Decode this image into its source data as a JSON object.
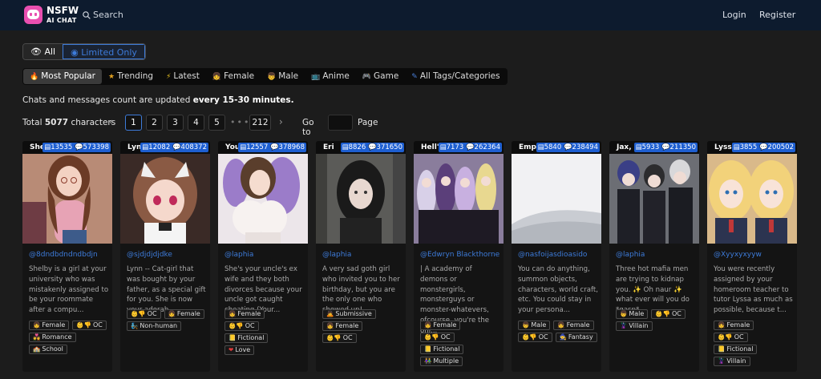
{
  "header": {
    "brand_line1": "NSFW",
    "brand_line2": "AI CHAT",
    "search_label": "Search",
    "login_label": "Login",
    "register_label": "Register",
    "colors": {
      "bar": "#0d1b2e",
      "logo": "#e94fb0"
    }
  },
  "filter": {
    "all_label": "All",
    "limited_label": "Limited Only"
  },
  "tags": [
    {
      "label": "Most Popular",
      "icon": "fire-icon",
      "active": true
    },
    {
      "label": "Trending",
      "icon": "star-icon"
    },
    {
      "label": "Latest",
      "icon": "bolt-icon"
    },
    {
      "label": "Female",
      "icon": "girl-icon"
    },
    {
      "label": "Male",
      "icon": "boy-icon"
    },
    {
      "label": "Anime",
      "icon": "tv-icon"
    },
    {
      "label": "Game",
      "icon": "gamepad-icon"
    },
    {
      "label": "All Tags/Categories",
      "icon": "pen-icon"
    }
  ],
  "notice": {
    "text": "Chats and messages count are updated ",
    "bold": "every 15-30 minutes."
  },
  "pagination": {
    "total_prefix": "Total ",
    "total_count": "5077",
    "total_suffix": " characters",
    "pages": [
      "1",
      "2",
      "3",
      "4",
      "5"
    ],
    "current": "1",
    "ellipsis": "•••",
    "last_page": "212",
    "goto_label": "Go to",
    "page_label": "Page",
    "accent": "#3d7bd9"
  },
  "cards": [
    {
      "name": "Shelby",
      "chats": "13535",
      "messages": "573398",
      "author": "@8dndbdndndbdjn",
      "description": "Shelby is a girl at your university who was mistakenly assigned to be your roommate after a compu...",
      "tags": [
        "Female",
        "OC",
        "Romance",
        "School"
      ]
    },
    {
      "name": "Lynn",
      "chats": "12082",
      "messages": "408372",
      "author": "@sjdjdjdjdke",
      "description": "Lynn -- Cat-girl that was bought by your father, as a special gift for you. She is now your adorab...",
      "tags": [
        "OC",
        "Female",
        "Non-human"
      ]
    },
    {
      "name": "Your bust",
      "chats": "12557",
      "messages": "378968",
      "author": "@laphia",
      "description": "She's your uncle's ex wife and they both divorces because your uncle got caught cheating (Your...",
      "tags": [
        "Female",
        "OC",
        "Fictional",
        "Love"
      ]
    },
    {
      "name": "Eri",
      "chats": "8826",
      "messages": "371650",
      "author": "@laphia",
      "description": "A very sad goth girl who invited you to her birthday, but you are the only one who showed up!",
      "tags": [
        "Submissive",
        "Female",
        "OC"
      ]
    },
    {
      "name": "Hell's acad",
      "chats": "7173",
      "messages": "262364",
      "author": "@Edwryn Blackthorne",
      "description": "| A academy of demons or monstergirls, monsterguys or monster-whatevers, ofcourse, you're the onl...",
      "tags": [
        "Female",
        "OC",
        "Fictional",
        "Multiple"
      ]
    },
    {
      "name": "Empty Spa",
      "chats": "5840",
      "messages": "238494",
      "author": "@nasfoijasdioasido",
      "description": "You can do anything, summon objects, characters, world craft, etc. You could stay in your persona...",
      "tags": [
        "Male",
        "Female",
        "OC",
        "Fantasy"
      ]
    },
    {
      "name": "Jax, grey, a",
      "chats": "5933",
      "messages": "211350",
      "author": "@laphia",
      "description": "Three hot mafia men are trying to kidnap you. ✨ Oh naur ✨ what ever will you do *gasp*",
      "tags": [
        "Male",
        "OC",
        "Villain"
      ]
    },
    {
      "name": "Lyssa",
      "chats": "3855",
      "messages": "200502",
      "author": "@Xyyxyxyyw",
      "description": "You were recently assigned by your homeroom teacher to tutor Lyssa as much as possible, because t...",
      "tags": [
        "Female",
        "OC",
        "Fictional",
        "Villain"
      ]
    }
  ]
}
